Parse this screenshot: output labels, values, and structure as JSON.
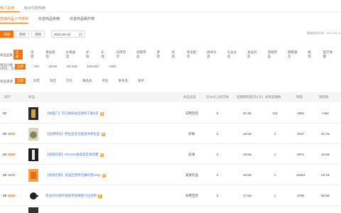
{
  "top_tabs": [
    {
      "label": "热门总榜",
      "active": true
    },
    {
      "label": "知识付费热榜",
      "active": false
    }
  ],
  "sub_tabs": [
    {
      "label": "直播商品人气榜单",
      "active": true
    },
    {
      "label": "抖音商品热榜",
      "active": false
    },
    {
      "label": "抖音商品飙升榜",
      "active": false
    }
  ],
  "date_buttons": [
    {
      "label": "日榜",
      "active": true
    },
    {
      "label": "周榜",
      "active": false
    },
    {
      "label": "月榜",
      "active": false
    }
  ],
  "date_value": "2021-05-10",
  "update_time": "数据更新时间：2021-05-11",
  "filters": {
    "category": {
      "label": "商品品类",
      "options": [
        "全部",
        "母婴",
        "家居家纺",
        "水果蔬菜",
        "护肤",
        "彩妆",
        "日用百货",
        "母婴用品",
        "游戏",
        "玩具",
        "珠宝配饰",
        "图书文具",
        "礼品文创",
        "食品饮料",
        "宠物用品",
        "鞋靴箱包",
        "服饰",
        "医疗保健"
      ],
      "active": "全部"
    },
    "price": {
      "label": "商品价格",
      "sublabel": "(单位：元)",
      "options": [
        "全部",
        "<20",
        "20-50",
        "50-100",
        "100-500",
        ">500"
      ],
      "active": "全部"
    },
    "source": {
      "label": "商品来源",
      "options": [
        "全部",
        "抖音",
        "淘宝",
        "京东",
        "唯品会",
        "考拉",
        "拼多多",
        "快手"
      ],
      "active": "全部"
    }
  },
  "table": {
    "headers": [
      "排行",
      "商品",
      "商品品类",
      "近30天上榜次数",
      "直播销售额(近1天)",
      "关联直播数",
      "销量",
      "销售额"
    ],
    "rows": [
      {
        "rank": "01",
        "new": "",
        "name": "【福临门】可口福味食品调料干散5克",
        "category": "日用百货",
        "count": "6",
        "gmv": "32.3w",
        "lives": "411",
        "sales": "1954",
        "amount": "4.5w"
      },
      {
        "rank": "02",
        "new": "NEW",
        "name": "【品牌特卖】养生壶多功能迷你养生壶",
        "category": "护肤",
        "count": "2",
        "gmv": "18.6w",
        "lives": "1",
        "sales": "3197",
        "amount": "21.7w"
      },
      {
        "rank": "03",
        "new": "NEW",
        "name": "【视频店家】PRAMY柏瑞美定妆喷雾",
        "category": "彩妆",
        "count": "2",
        "gmv": "18.6w",
        "lives": "1",
        "sales": "4674",
        "amount": "16.8w"
      },
      {
        "rank": "04",
        "new": "NEW",
        "name": "【视频店家】美国全营养代餐奶昔120g",
        "category": "美食饮品",
        "count": "2",
        "gmv": "16.6w",
        "lives": "1",
        "sales": "11694",
        "amount": "23.7w"
      },
      {
        "rank": "05",
        "new": "NEW",
        "name": "苏泊尔炒锅不粘锅平底锅燃气灶适用",
        "category": "日用百货",
        "count": "2",
        "gmv": "17.6w",
        "lives": "1",
        "sales": "4799",
        "amount": "95.9w"
      }
    ]
  },
  "colors": {
    "accent": "#f5740f",
    "link": "#4a7be8"
  }
}
